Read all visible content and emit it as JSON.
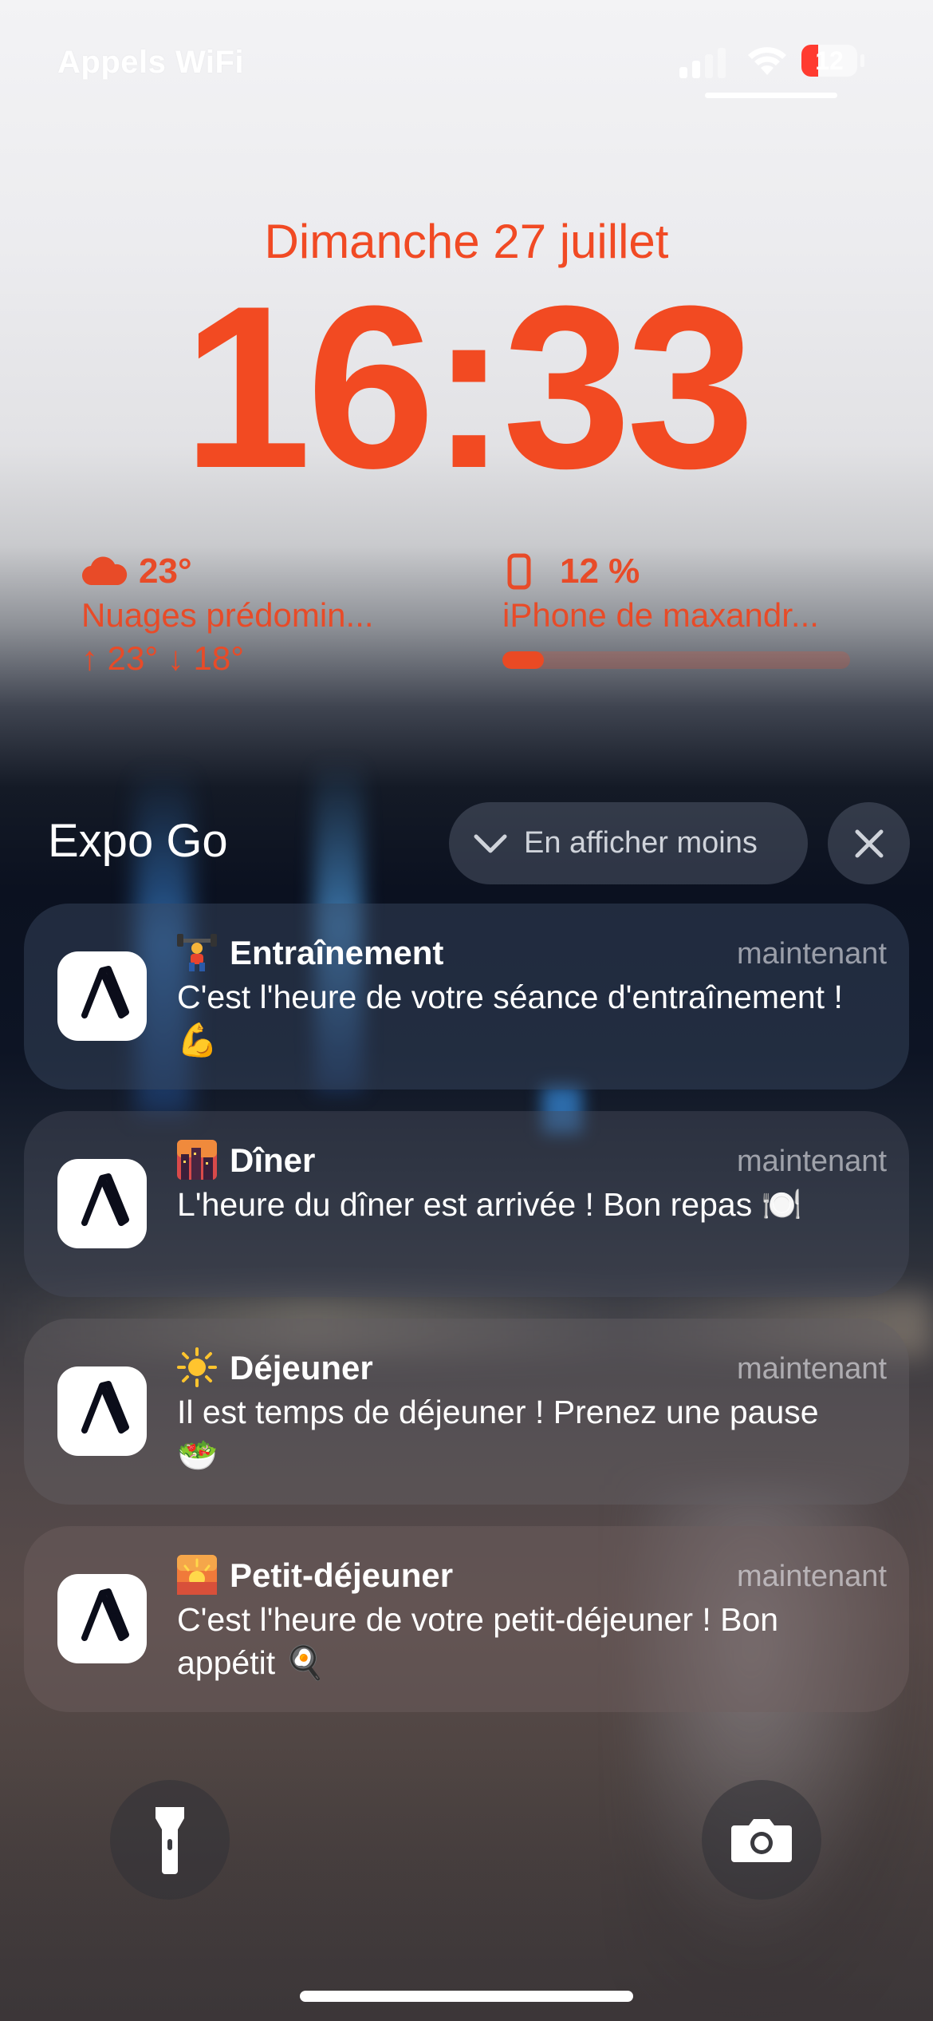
{
  "status_bar": {
    "carrier": "Appels WiFi",
    "battery_level": "12",
    "battery_fraction": 0.12,
    "battery_color": "#ff3b30"
  },
  "lock_screen": {
    "date": "Dimanche 27 juillet",
    "time": "16:33",
    "accent_color": "#f24a22"
  },
  "widgets": {
    "weather": {
      "icon": "cloud-icon",
      "temperature": "23°",
      "condition": "Nuages prédomin...",
      "range": "↑ 23° ↓ 18°"
    },
    "battery": {
      "icon": "iphone-icon",
      "level": "12 %",
      "device": "iPhone de maxandr...",
      "fraction": 0.12
    }
  },
  "notification_group": {
    "app_name": "Expo Go",
    "show_less_label": "En afficher moins",
    "close_icon": "close-icon"
  },
  "notifications": [
    {
      "emoji": "weightlifter",
      "title": "Entraînement",
      "time": "maintenant",
      "body": "C'est l'heure de votre séance d'entraînement ! 💪"
    },
    {
      "emoji": "city-sunset",
      "title": "Dîner",
      "time": "maintenant",
      "body": "L'heure du dîner est arrivée ! Bon repas 🍽️"
    },
    {
      "emoji": "sun",
      "title": "Déjeuner",
      "time": "maintenant",
      "body": "Il est temps de déjeuner ! Prenez une pause 🥗"
    },
    {
      "emoji": "sunrise",
      "title": "Petit-déjeuner",
      "time": "maintenant",
      "body": "C'est l'heure de votre petit-déjeuner ! Bon appétit 🍳"
    }
  ],
  "bottom_controls": {
    "left": "flashlight-icon",
    "right": "camera-icon"
  }
}
